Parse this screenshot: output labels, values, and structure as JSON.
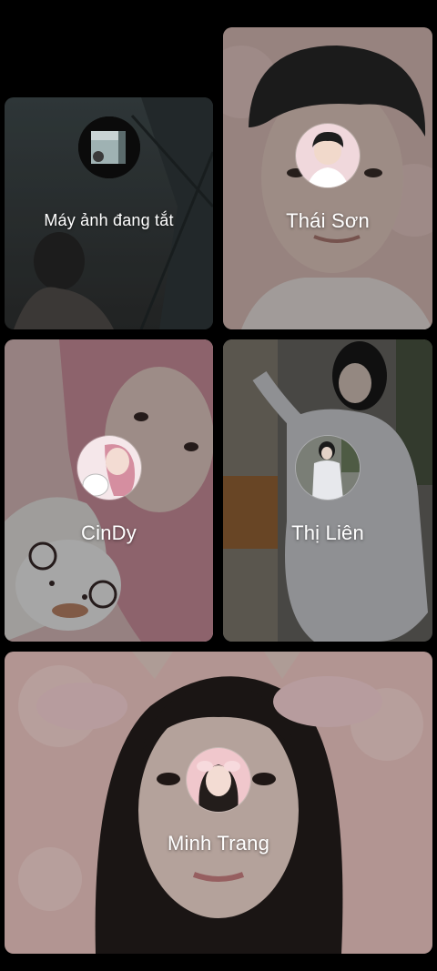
{
  "participants": [
    {
      "id": "self",
      "label": "Máy ảnh đang tắt",
      "camera_off": true
    },
    {
      "id": "thai-son",
      "label": "Thái Sơn"
    },
    {
      "id": "cindy",
      "label": "CinDy"
    },
    {
      "id": "thi-lien",
      "label": "Thị Liên"
    },
    {
      "id": "minh-trang",
      "label": "Minh Trang"
    }
  ],
  "colors": {
    "background": "#000000",
    "label": "#ffffff",
    "pink_tone": "#e8b8b8",
    "gray_tone": "#6b6f72"
  }
}
